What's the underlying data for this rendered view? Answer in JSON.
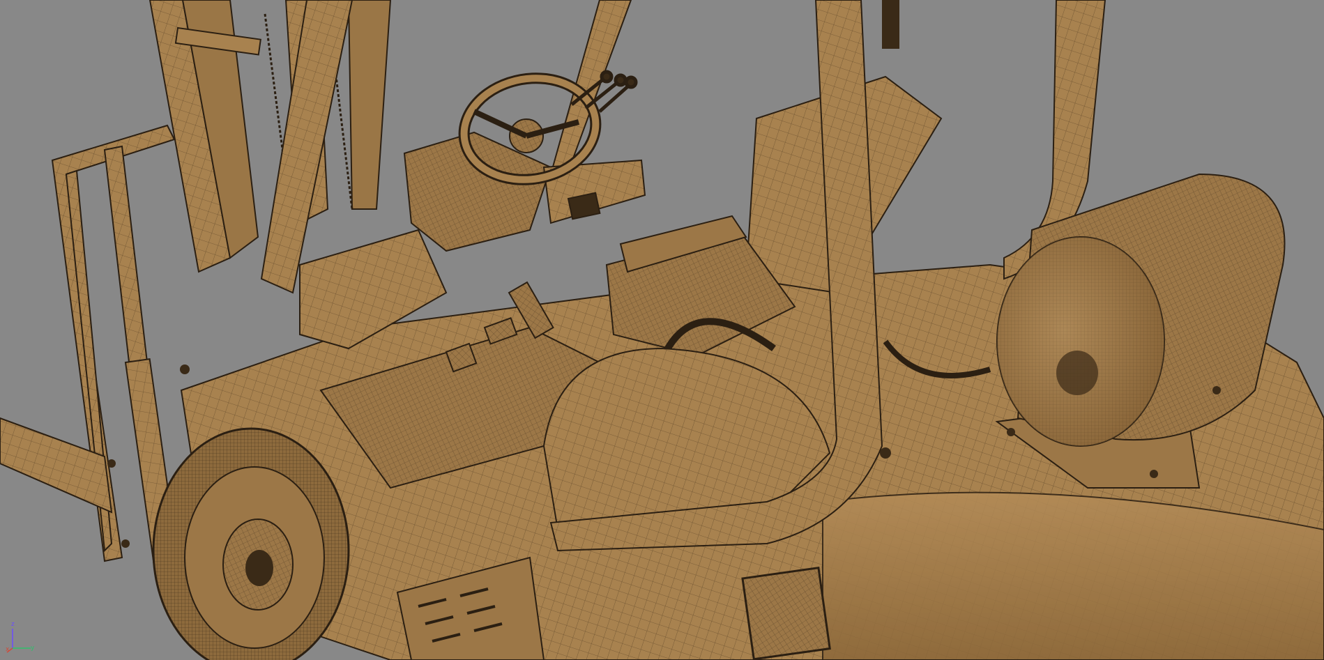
{
  "viewport": {
    "background": "#888888",
    "model": {
      "base_color": "#a8824f",
      "highlight_color": "#c19a66",
      "shadow_color": "#6e532f",
      "wire_color": "#2b1f12"
    }
  },
  "axis_gizmo": {
    "z_label": "z",
    "x_label": "x",
    "y_label": "y",
    "z_color": "#6a4cff",
    "x_color": "#d04b3a",
    "y_color": "#2fbf6b"
  }
}
